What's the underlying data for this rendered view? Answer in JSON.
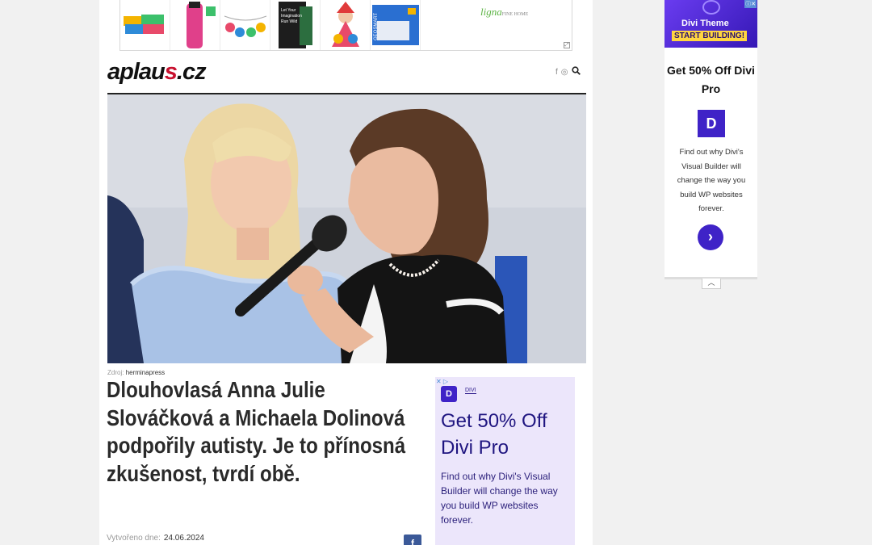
{
  "top_ad": {
    "brand": "ligna",
    "brand_sub": "FINE HOME",
    "corner_icon": "adchoices-corner-icon",
    "product_book_text": "Let Your Imagination Run Wild"
  },
  "header": {
    "logo_main": "aplau",
    "logo_accent": "s",
    "logo_tld": ".cz",
    "icons": [
      "facebook-icon",
      "instagram-icon",
      "search-icon"
    ]
  },
  "article": {
    "photo_credit_label": "Zdroj:",
    "photo_credit_value": "herminapress",
    "headline": "Dlouhovlasá Anna Julie Slováčková a Michaela Dolinová podpořily autisty. Je to přínosná zkušenost, tvrdí obě.",
    "created_label": "Vytvořeno dne:",
    "created_value": "24.06.2024",
    "share_icon": "facebook-share-icon"
  },
  "inline_ad": {
    "badge": "✕ ▷",
    "brand_logo_letter": "D",
    "brand": "DIVI",
    "title": "Get 50% Off Divi Pro",
    "description": "Find out why Divi's Visual Builder will change the way you build WP websites forever."
  },
  "sidebar_ad": {
    "banner_line1": "Divi Theme",
    "banner_line2": "START BUILDING!",
    "adchoices": "ⓘ✕",
    "title": "Get 50% Off Divi Pro",
    "logo_letter": "D",
    "description": "Find out why Divi's Visual Builder will change the way you build WP websites forever.",
    "cta_icon": "chevron-right-icon",
    "collapse_icon": "chevron-up-icon"
  },
  "colors": {
    "divi_purple": "#3f23c7",
    "ad_bg": "#ece6fb",
    "logo_red": "#c8102e",
    "facebook_blue": "#3b5998"
  }
}
